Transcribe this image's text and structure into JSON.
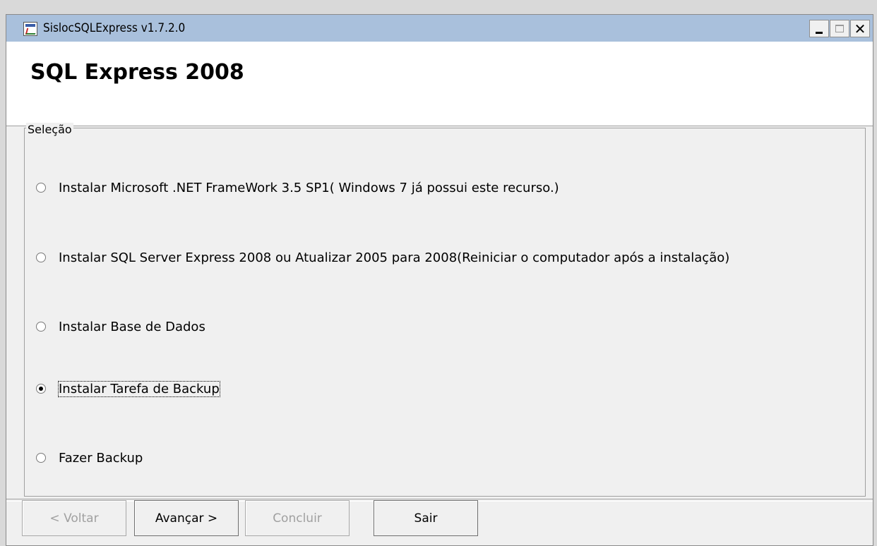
{
  "window": {
    "title": "SislocSQLExpress v1.7.2.0",
    "controls": {
      "minimize": "_",
      "maximize": "□",
      "close": "✕"
    }
  },
  "header": {
    "title": "SQL Express 2008"
  },
  "selection": {
    "label": "Seleção",
    "options": [
      {
        "label": "Instalar Microsoft .NET FrameWork 3.5 SP1( Windows 7 já possui este recurso.)",
        "selected": false
      },
      {
        "label": "Instalar SQL Server Express 2008 ou Atualizar 2005 para 2008(Reiniciar o computador após a instalação)",
        "selected": false
      },
      {
        "label": "Instalar Base de Dados",
        "selected": false
      },
      {
        "label": "Instalar Tarefa de Backup",
        "selected": true
      },
      {
        "label": "Fazer Backup",
        "selected": false
      }
    ]
  },
  "buttons": {
    "back": "< Voltar",
    "next": "Avançar >",
    "finish": "Concluir",
    "exit": "Sair"
  }
}
